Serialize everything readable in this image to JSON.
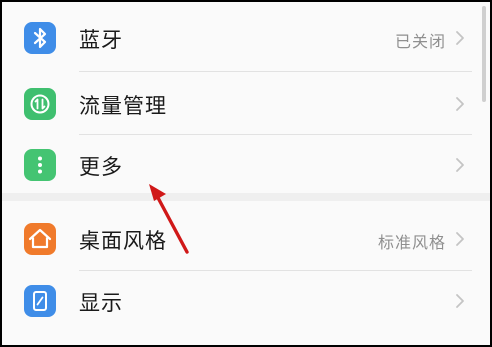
{
  "settings": {
    "items": [
      {
        "label": "蓝牙",
        "value": "已关闭",
        "icon": "bluetooth-icon",
        "color": "#3f8de8"
      },
      {
        "label": "流量管理",
        "value": "",
        "icon": "data-usage-icon",
        "color": "#3fbf6f"
      },
      {
        "label": "更多",
        "value": "",
        "icon": "more-dots-icon",
        "color": "#44c472"
      },
      {
        "label": "桌面风格",
        "value": "标准风格",
        "icon": "home-style-icon",
        "color": "#f07a2b"
      },
      {
        "label": "显示",
        "value": "",
        "icon": "display-icon",
        "color": "#3f8de8"
      }
    ]
  },
  "annotation": {
    "arrow_color": "#d01818"
  }
}
